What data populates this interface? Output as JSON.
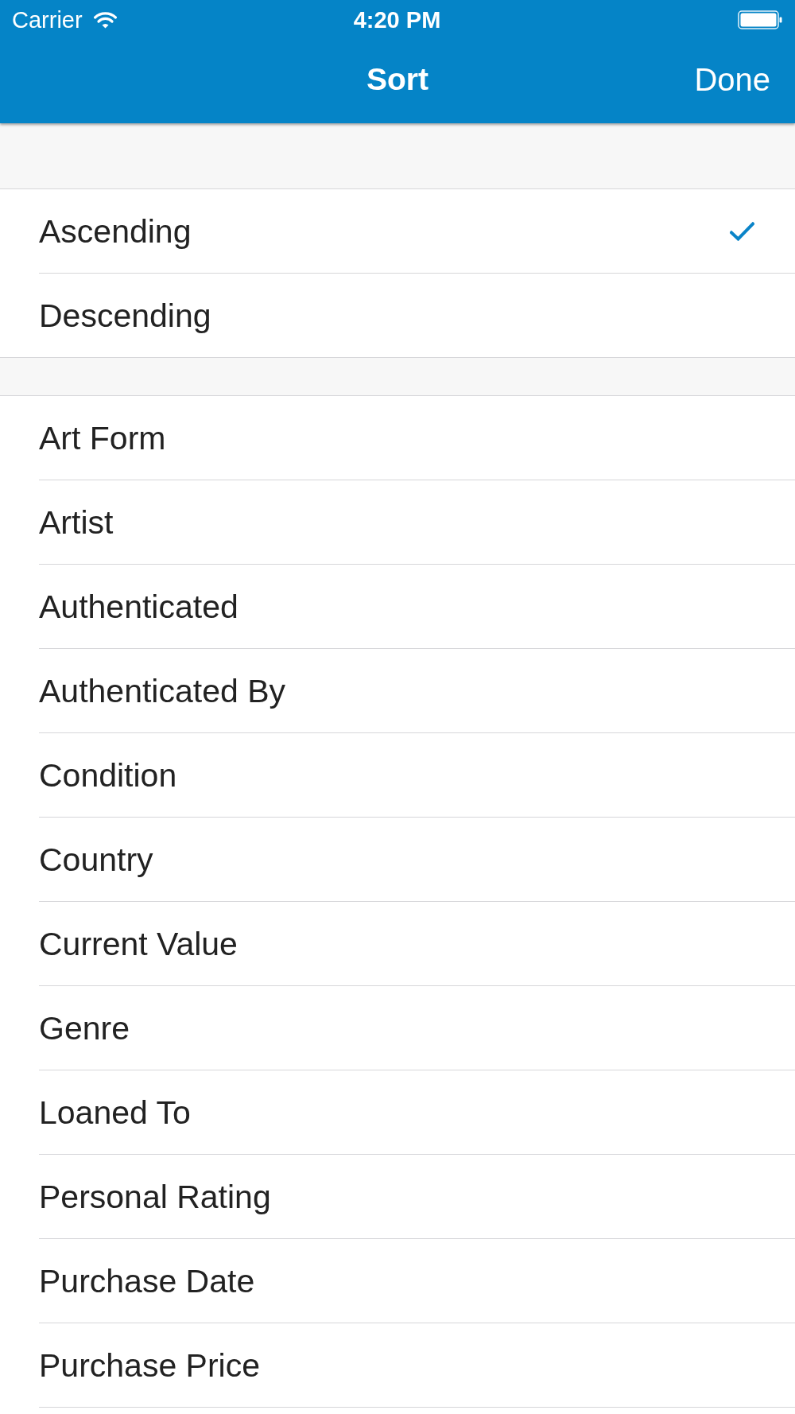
{
  "status_bar": {
    "carrier": "Carrier",
    "time": "4:20 PM"
  },
  "nav_bar": {
    "title": "Sort",
    "done_button": "Done"
  },
  "sections": [
    {
      "items": [
        {
          "label": "Ascending",
          "selected": true
        },
        {
          "label": "Descending",
          "selected": false
        }
      ]
    },
    {
      "items": [
        {
          "label": "Art Form",
          "selected": false
        },
        {
          "label": "Artist",
          "selected": false
        },
        {
          "label": "Authenticated",
          "selected": false
        },
        {
          "label": "Authenticated By",
          "selected": false
        },
        {
          "label": "Condition",
          "selected": false
        },
        {
          "label": "Country",
          "selected": false
        },
        {
          "label": "Current Value",
          "selected": false
        },
        {
          "label": "Genre",
          "selected": false
        },
        {
          "label": "Loaned To",
          "selected": false
        },
        {
          "label": "Personal Rating",
          "selected": false
        },
        {
          "label": "Purchase Date",
          "selected": false
        },
        {
          "label": "Purchase Price",
          "selected": false
        }
      ]
    }
  ]
}
